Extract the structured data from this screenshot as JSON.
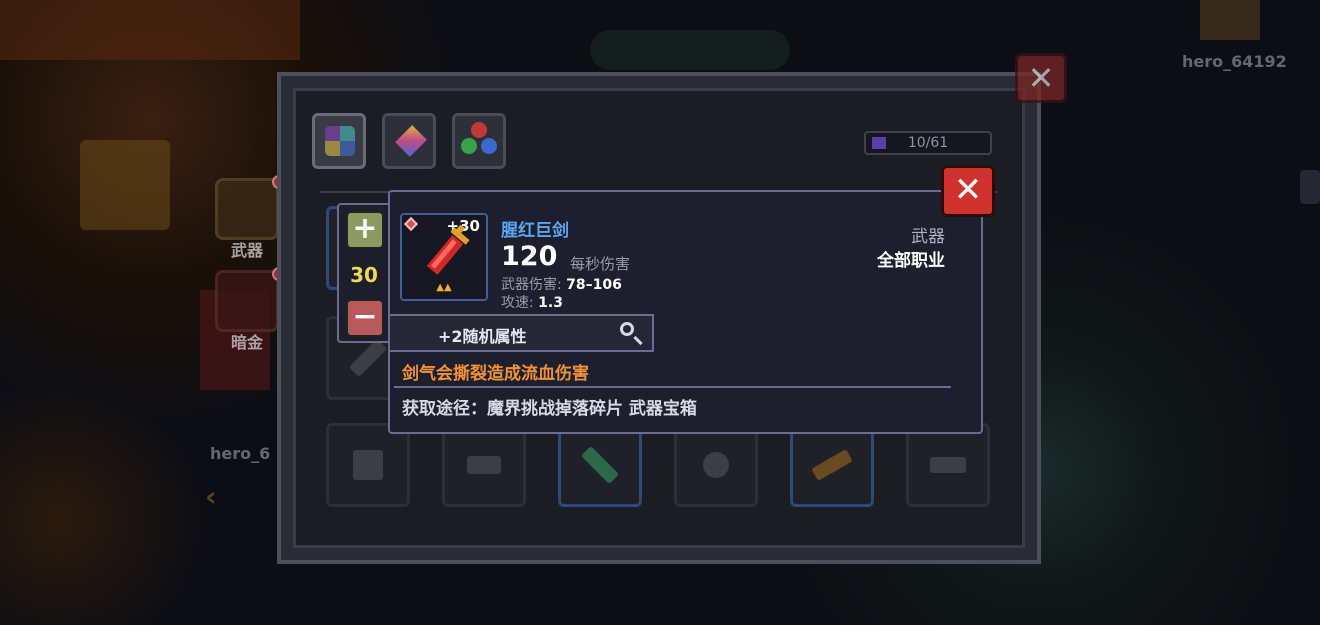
{
  "scene": {
    "player_names": [
      "hero_64192",
      "hero_6"
    ],
    "side_tabs": [
      {
        "label": "武器",
        "icon": "helmet-icon"
      },
      {
        "label": "暗金",
        "icon": "chest-icon"
      }
    ]
  },
  "inventory": {
    "tabs": [
      {
        "icon": "grid-icon"
      },
      {
        "icon": "crystal-icon"
      },
      {
        "icon": "orbs-icon"
      }
    ],
    "capacity": "10/61"
  },
  "quantity": {
    "plus_label": "+",
    "minus_label": "−",
    "value": "30"
  },
  "item": {
    "name": "腥红巨剑",
    "enhance_level": "+30",
    "dps_value": "120",
    "dps_label": "每秒伤害",
    "damage_label": "武器伤害: ",
    "damage_value": "78–106",
    "speed_label": "攻速: ",
    "speed_value": "1.3",
    "type": "武器",
    "class": "全部职业",
    "stars": "▲▲",
    "random_attr": "+2随机属性",
    "effect": "剑气会撕裂造成流血伤害",
    "source": "获取途径：魔界挑战掉落碎片 武器宝箱",
    "icon": "red-sword-icon"
  },
  "buttons": {
    "close_label": "✕"
  },
  "colors": {
    "item_name": "#5aa7f0",
    "effect": "#f29238",
    "quantity": "#f2d84e",
    "close_button": "#d0312c"
  }
}
